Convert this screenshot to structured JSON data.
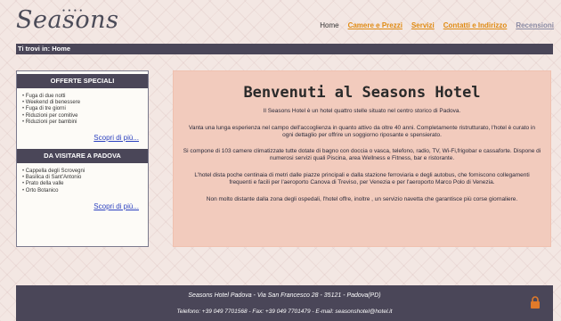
{
  "header": {
    "logo_text": "Seasons",
    "nav": [
      "Home",
      "Camere e Prezzi",
      "Servizi",
      "Contatti e Indirizzo",
      "Recensioni"
    ]
  },
  "breadcrumb": "Ti trovi in: Home",
  "sidebar": {
    "sections": [
      {
        "title": "OFFERTE SPECIALI",
        "items": [
          "Fuga di due notti",
          "Weekend di benessere",
          "Fuga di tre giorni",
          "Riduzioni per comitive",
          "Riduzioni per bambini"
        ],
        "more": "Scopri di più..."
      },
      {
        "title": "DA VISITARE A PADOVA",
        "items": [
          "Cappella degli Scrovegni",
          "Basilica di Sant'Antonio",
          "Prato della valle",
          "Orto Botanico"
        ],
        "more": "Scopri di più..."
      }
    ]
  },
  "main": {
    "title": "Benvenuti al Seasons Hotel",
    "paragraphs": [
      "Il Seasons Hotel è un hotel quattro stelle situato nel centro storico di Padova.",
      "Vanta una lunga esperienza nel campo dell'accoglienza in quanto attivo da oltre 40 anni. Completamente ristrutturato, l'hotel è curato in ogni dettaglio per offrire un soggiorno riposante e spensierato.",
      "Si compone di 103 camere climatizzate tutte dotate di bagno con doccia o vasca, telefono, radio, TV, Wi-Fi,frigobar e cassaforte. Dispone di numerosi servizi quali Piscina, area Wellness e Fitness, bar e ristorante.",
      "L'hotel dista poche centinaia di metri dalle piazze principali e dalla stazione ferroviaria e degli autobus, che forniscono collegamenti frequenti e facili per l'aeroporto Canova di Treviso, per Venezia e per l'aeroporto Marco Polo di Venezia.",
      "Non molto distante dalla zona degli ospedali, l'hotel offre, inoltre , un servizio navetta che garantisce più corse giornaliere."
    ]
  },
  "footer": {
    "line1": "Seasons Hotel Padova - Via San Francesco 28 - 35121 - Padova(PD)",
    "line2": "Telefono: +39 049 7701568 - Fax: +39 049 7701479 - E-mail: seasonshotel@hotel.it"
  },
  "colors": {
    "accent_orange": "#e08a10",
    "bar_dark": "#4a4658",
    "main_panel": "#f2cbbd",
    "link_blue": "#2a3fbf"
  },
  "icons": {
    "footer": "lock-icon"
  }
}
